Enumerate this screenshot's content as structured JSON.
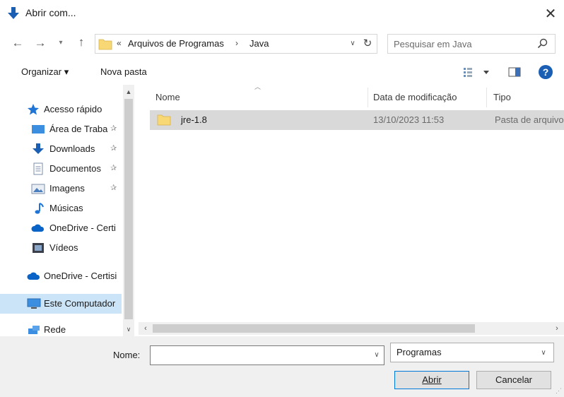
{
  "window": {
    "title": "Abrir com...",
    "close_glyph": "✕"
  },
  "address": {
    "overflow_glyph": "«",
    "segments": [
      "Arquivos de Programas",
      "Java"
    ],
    "separator_glyph": "›",
    "refresh_glyph": "↻"
  },
  "search": {
    "placeholder": "Pesquisar em Java"
  },
  "toolbar": {
    "organize_label": "Organizar ▾",
    "new_folder_label": "Nova pasta",
    "help_glyph": "?"
  },
  "nav_pane": {
    "items": [
      {
        "label": "Acesso rápido",
        "icon": "star-icon",
        "pinned": false
      },
      {
        "label": "Área de Traba",
        "icon": "desktop-icon",
        "pinned": true
      },
      {
        "label": "Downloads",
        "icon": "download-icon",
        "pinned": true
      },
      {
        "label": "Documentos",
        "icon": "document-icon",
        "pinned": true
      },
      {
        "label": "Imagens",
        "icon": "images-icon",
        "pinned": true
      },
      {
        "label": "Músicas",
        "icon": "music-icon",
        "pinned": false
      },
      {
        "label": "OneDrive - Certi",
        "icon": "cloud-icon",
        "pinned": false
      },
      {
        "label": "Vídeos",
        "icon": "video-icon",
        "pinned": false
      },
      {
        "label": "OneDrive - Certisi",
        "icon": "cloud-icon",
        "pinned": false
      },
      {
        "label": "Este Computador",
        "icon": "computer-icon",
        "pinned": false,
        "selected": true
      },
      {
        "label": "Rede",
        "icon": "network-icon",
        "pinned": false
      }
    ],
    "pin_glyph": "✰"
  },
  "file_list": {
    "columns": [
      "Nome",
      "Data de modificação",
      "Tipo"
    ],
    "rows": [
      {
        "name": "jre-1.8",
        "date": "13/10/2023 11:53",
        "type": "Pasta de arquivo"
      }
    ]
  },
  "bottom": {
    "name_label": "Nome:",
    "name_value": "",
    "filter_value": "Programas",
    "open_label": "Abrir",
    "cancel_label": "Cancelar"
  },
  "colors": {
    "accent": "#0078d7",
    "selection": "#cce4f7",
    "row_highlight": "#d9d9d9",
    "folder": "#f8d775"
  }
}
